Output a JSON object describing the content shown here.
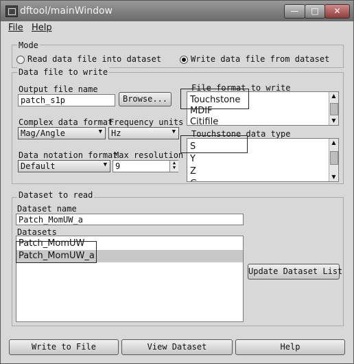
{
  "window": {
    "title": "dftool/mainWindow",
    "minimize_glyph": "—",
    "maximize_glyph": "□",
    "close_glyph": "✕"
  },
  "menu": {
    "file": "File",
    "help": "Help"
  },
  "mode": {
    "title": "Mode",
    "read_label": "Read data file into dataset",
    "write_label": "Write data file from dataset",
    "selected": "write"
  },
  "data_file": {
    "title": "Data file to write",
    "output_label": "Output file name",
    "output_value": "patch_s1p",
    "browse_label": "Browse...",
    "complex_label": "Complex data format",
    "complex_value": "Mag/Angle",
    "freq_label": "Frequency units",
    "freq_value": "Hz",
    "notation_label": "Data notation format",
    "notation_value": "Default",
    "maxres_label": "Max resolution",
    "maxres_value": "9",
    "format_label": "File format to write",
    "formats": [
      "Touchstone",
      "MDIF",
      "Citifile"
    ],
    "touchstone_label": "Touchstone data type",
    "touchstone_types": [
      "S",
      "Y",
      "Z",
      "G"
    ]
  },
  "dataset": {
    "title": "Dataset to read",
    "name_label": "Dataset name",
    "name_value": "Patch_MomUW_a",
    "datasets_label": "Datasets",
    "datasets": [
      "Patch_MomUW",
      "Patch_MomUW_a"
    ],
    "update_label": "Update Dataset List"
  },
  "footer": {
    "write": "Write to File",
    "view": "View Dataset",
    "help": "Help"
  },
  "colors": {
    "accent": "#6a6a6a",
    "selection": "#c8c8c8"
  }
}
